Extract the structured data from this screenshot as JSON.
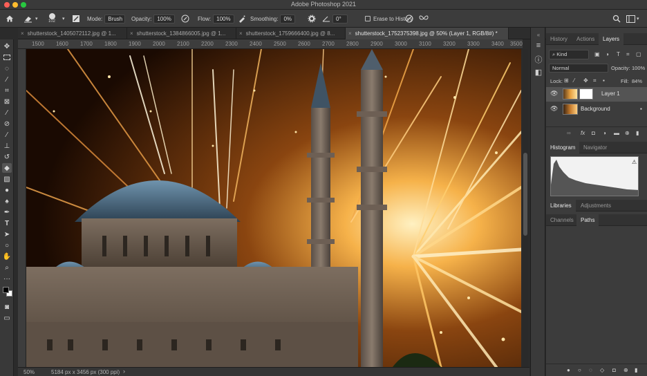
{
  "window": {
    "title": "Adobe Photoshop 2021"
  },
  "options_bar": {
    "brush_size": "102",
    "mode_label": "Mode:",
    "mode_value": "Brush",
    "opacity_label": "Opacity:",
    "opacity_value": "100%",
    "flow_label": "Flow:",
    "flow_value": "100%",
    "smoothing_label": "Smoothing:",
    "smoothing_value": "0%",
    "angle_value": "0°",
    "erase_history_label": "Erase to History"
  },
  "tabs": [
    {
      "label": "shutterstock_1405072112.jpg @ 1..."
    },
    {
      "label": "shutterstock_1384866005.jpg @ 1..."
    },
    {
      "label": "shutterstock_1759666400.jpg @ 8..."
    },
    {
      "label": "shutterstock_1752375398.jpg @ 50% (Layer 1, RGB/8#) *"
    }
  ],
  "ruler": {
    "ticks": [
      "1500",
      "1600",
      "1700",
      "1800",
      "1900",
      "2000",
      "2100",
      "2200",
      "2300",
      "2400",
      "2500",
      "2600",
      "2700",
      "2800",
      "2900",
      "3000",
      "3100",
      "3200",
      "3300",
      "3400",
      "3500"
    ]
  },
  "status": {
    "zoom": "50%",
    "doc_size": "5184 px x 3456 px (300 ppi)"
  },
  "layers_panel": {
    "tabs": [
      {
        "label": "History"
      },
      {
        "label": "Actions"
      },
      {
        "label": "Layers"
      }
    ],
    "kind_filter": "Kind",
    "blend_mode": "Normal",
    "opacity_label": "Opacity:",
    "opacity_value": "100%",
    "lock_label": "Lock:",
    "fill_label": "Fill:",
    "fill_value": "84%",
    "layers": [
      {
        "name": "Layer 1"
      },
      {
        "name": "Background"
      }
    ]
  },
  "histogram_panel": {
    "tabs": [
      {
        "label": "Histogram"
      },
      {
        "label": "Navigator"
      }
    ]
  },
  "libraries_panel": {
    "tabs": [
      {
        "label": "Libraries"
      },
      {
        "label": "Adjustments"
      }
    ]
  },
  "channels_panel": {
    "tabs": [
      {
        "label": "Channels"
      },
      {
        "label": "Paths"
      }
    ]
  }
}
